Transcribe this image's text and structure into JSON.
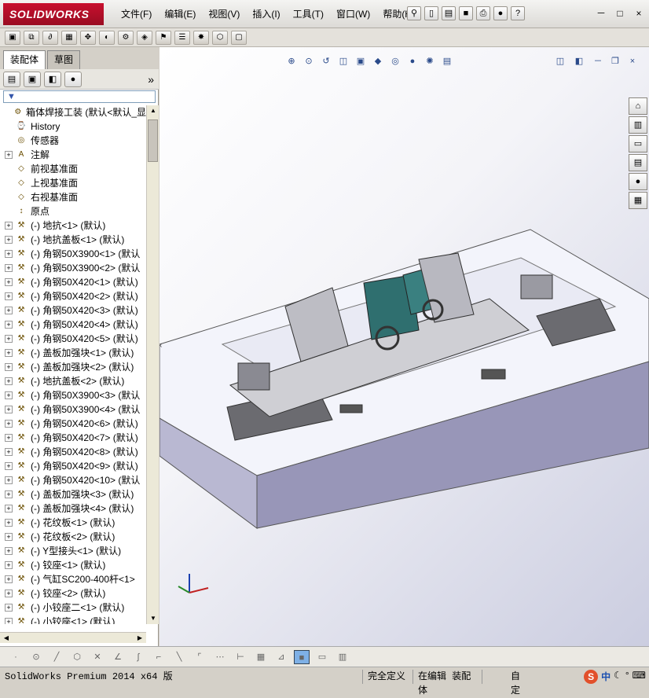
{
  "app": {
    "logo_text": "SOLIDWORKS"
  },
  "menu": [
    {
      "label": "文件(F)"
    },
    {
      "label": "编辑(E)"
    },
    {
      "label": "视图(V)"
    },
    {
      "label": "插入(I)"
    },
    {
      "label": "工具(T)"
    },
    {
      "label": "窗口(W)"
    },
    {
      "label": "帮助(H)"
    }
  ],
  "title_tools": [
    "pin-icon",
    "new-file-icon",
    "open-file-icon",
    "save-icon",
    "print-icon",
    "traffic-light-icon",
    "help-icon"
  ],
  "window_buttons": {
    "minimize": "－",
    "restore": "□",
    "close": "×"
  },
  "panel": {
    "tabs": [
      {
        "label": "装配体"
      },
      {
        "label": "草图"
      }
    ],
    "filter": "▼",
    "tree": [
      {
        "label": "箱体焊接工装   (默认<默认_显",
        "icon": "assembly-icon",
        "expand": false
      },
      {
        "label": "History",
        "icon": "history-icon",
        "expand": false
      },
      {
        "label": "传感器",
        "icon": "sensor-icon",
        "expand": false
      },
      {
        "label": "注解",
        "icon": "annotation-icon",
        "expand": true
      },
      {
        "label": "前视基准面",
        "icon": "plane-icon",
        "expand": false
      },
      {
        "label": "上视基准面",
        "icon": "plane-icon",
        "expand": false
      },
      {
        "label": "右视基准面",
        "icon": "plane-icon",
        "expand": false
      },
      {
        "label": "原点",
        "icon": "origin-icon",
        "expand": false
      },
      {
        "label": "(-) 地抗<1> (默认)",
        "icon": "part-icon",
        "expand": true
      },
      {
        "label": "(-) 地抗盖板<1> (默认)",
        "icon": "part-icon",
        "expand": true
      },
      {
        "label": "(-) 角钢50X3900<1> (默认",
        "icon": "part-icon",
        "expand": true
      },
      {
        "label": "(-) 角钢50X3900<2> (默认",
        "icon": "part-icon",
        "expand": true
      },
      {
        "label": "(-) 角钢50X420<1> (默认)",
        "icon": "part-icon",
        "expand": true
      },
      {
        "label": "(-) 角钢50X420<2> (默认)",
        "icon": "part-icon",
        "expand": true
      },
      {
        "label": "(-) 角钢50X420<3> (默认)",
        "icon": "part-icon",
        "expand": true
      },
      {
        "label": "(-) 角钢50X420<4> (默认)",
        "icon": "part-icon",
        "expand": true
      },
      {
        "label": "(-) 角钢50X420<5> (默认)",
        "icon": "part-icon",
        "expand": true
      },
      {
        "label": "(-) 盖板加强块<1> (默认)",
        "icon": "part-icon",
        "expand": true
      },
      {
        "label": "(-) 盖板加强块<2> (默认)",
        "icon": "part-icon",
        "expand": true
      },
      {
        "label": "(-) 地抗盖板<2> (默认)",
        "icon": "part-icon",
        "expand": true
      },
      {
        "label": "(-) 角钢50X3900<3> (默认",
        "icon": "part-icon",
        "expand": true
      },
      {
        "label": "(-) 角钢50X3900<4> (默认",
        "icon": "part-icon",
        "expand": true
      },
      {
        "label": "(-) 角钢50X420<6> (默认)",
        "icon": "part-icon",
        "expand": true
      },
      {
        "label": "(-) 角钢50X420<7> (默认)",
        "icon": "part-icon",
        "expand": true
      },
      {
        "label": "(-) 角钢50X420<8> (默认)",
        "icon": "part-icon",
        "expand": true
      },
      {
        "label": "(-) 角钢50X420<9> (默认)",
        "icon": "part-icon",
        "expand": true
      },
      {
        "label": "(-) 角钢50X420<10> (默认",
        "icon": "part-icon",
        "expand": true
      },
      {
        "label": "(-) 盖板加强块<3> (默认)",
        "icon": "part-icon",
        "expand": true
      },
      {
        "label": "(-) 盖板加强块<4> (默认)",
        "icon": "part-icon",
        "expand": true
      },
      {
        "label": "(-) 花纹板<1> (默认)",
        "icon": "part-icon",
        "expand": true
      },
      {
        "label": "(-) 花纹板<2> (默认)",
        "icon": "part-icon",
        "expand": true
      },
      {
        "label": "(-) Y型接头<1> (默认)",
        "icon": "part-icon",
        "expand": true
      },
      {
        "label": "(-) 铰座<1> (默认)",
        "icon": "part-icon",
        "expand": true
      },
      {
        "label": "(-) 气缸SC200-400杆<1>",
        "icon": "part-icon",
        "expand": true
      },
      {
        "label": "(-) 铰座<2> (默认)",
        "icon": "part-icon",
        "expand": true
      },
      {
        "label": "(-) 小铰座二<1> (默认)",
        "icon": "part-icon",
        "expand": true
      },
      {
        "label": "(-) 小铰座<1> (默认)",
        "icon": "part-icon",
        "expand": true
      }
    ]
  },
  "viewport": {
    "bg_top": "#ffffff",
    "bg_bottom": "#cbcde0"
  },
  "status": {
    "product": "SolidWorks Premium 2014 x64 版",
    "underdefined": "完全定义",
    "editing": "在编辑 装配体",
    "custom": "自定"
  }
}
